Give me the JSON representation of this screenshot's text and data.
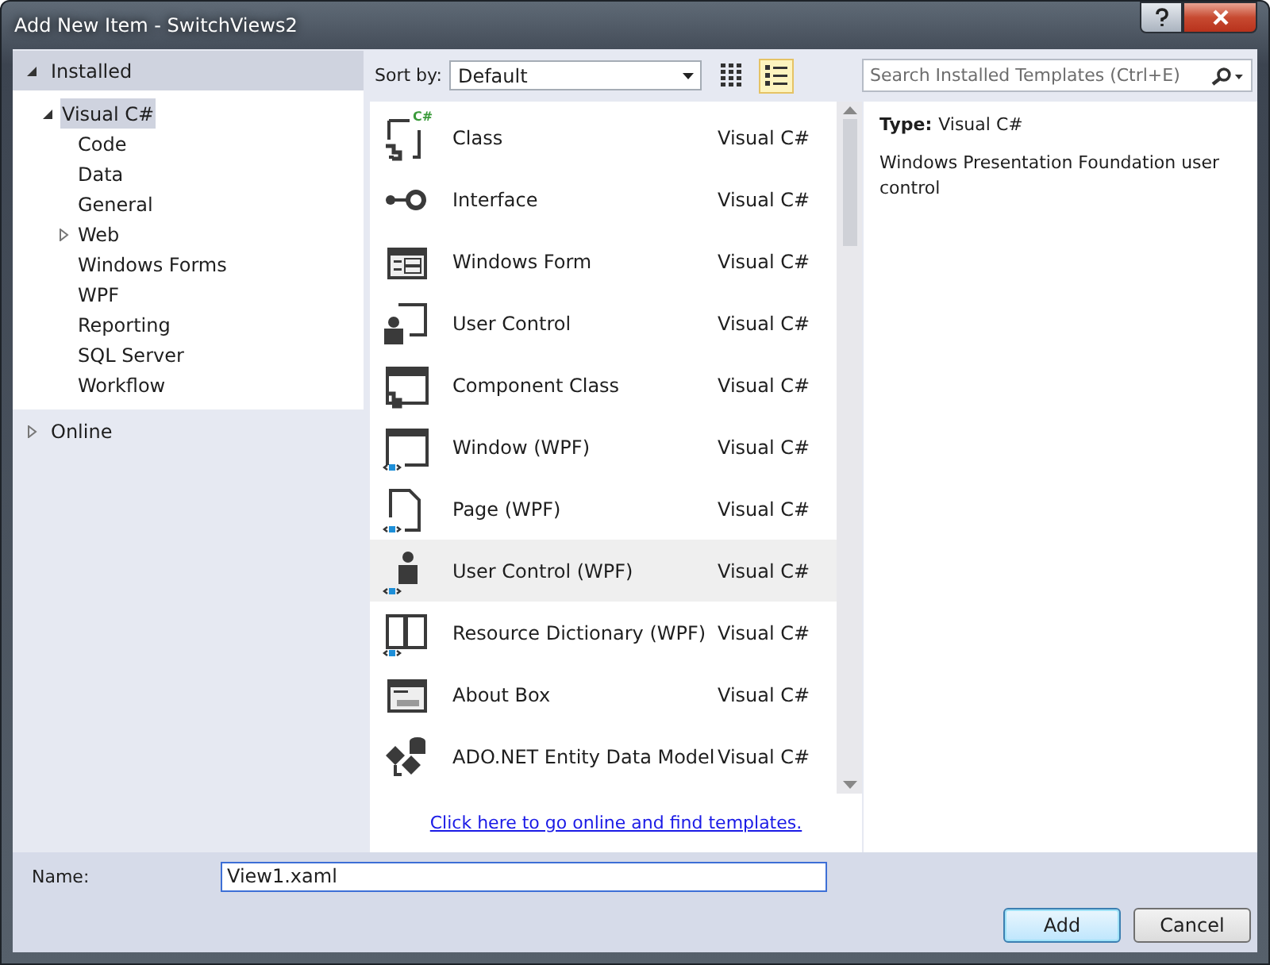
{
  "window": {
    "title": "Add New Item - SwitchViews2"
  },
  "sidebar": {
    "sections": [
      {
        "label": "Installed",
        "expanded": true,
        "children": [
          {
            "label": "Visual C#",
            "selected": true,
            "expanded": true,
            "children": [
              {
                "label": "Code",
                "selected": false
              },
              {
                "label": "Data",
                "selected": false
              },
              {
                "label": "General",
                "selected": false
              },
              {
                "label": "Web",
                "selected": false,
                "expanded": false
              },
              {
                "label": "Windows Forms",
                "selected": false
              },
              {
                "label": "WPF",
                "selected": false
              },
              {
                "label": "Reporting",
                "selected": false
              },
              {
                "label": "SQL Server",
                "selected": false
              },
              {
                "label": "Workflow",
                "selected": false
              }
            ]
          }
        ]
      },
      {
        "label": "Online",
        "expanded": false
      }
    ]
  },
  "toolbar": {
    "sort_label": "Sort by:",
    "sort_value": "Default",
    "views": [
      {
        "kind": "small-icons",
        "selected": false
      },
      {
        "kind": "list",
        "selected": true
      }
    ],
    "search": {
      "placeholder": "Search Installed Templates (Ctrl+E)"
    }
  },
  "templates": [
    {
      "name": "Class",
      "language": "Visual C#",
      "selected": false,
      "icon_badge": "C#"
    },
    {
      "name": "Interface",
      "language": "Visual C#",
      "selected": false
    },
    {
      "name": "Windows Form",
      "language": "Visual C#",
      "selected": false
    },
    {
      "name": "User Control",
      "language": "Visual C#",
      "selected": false
    },
    {
      "name": "Component Class",
      "language": "Visual C#",
      "selected": false
    },
    {
      "name": "Window (WPF)",
      "language": "Visual C#",
      "selected": false
    },
    {
      "name": "Page (WPF)",
      "language": "Visual C#",
      "selected": false
    },
    {
      "name": "User Control (WPF)",
      "language": "Visual C#",
      "selected": true
    },
    {
      "name": "Resource Dictionary (WPF)",
      "language": "Visual C#",
      "selected": false
    },
    {
      "name": "About Box",
      "language": "Visual C#",
      "selected": false
    },
    {
      "name": "ADO.NET Entity Data Model",
      "language": "Visual C#",
      "selected": false
    }
  ],
  "online_link": "Click here to go online and find templates.",
  "details": {
    "type_label": "Type:",
    "type_value": "Visual C#",
    "description": "Windows Presentation Foundation user control"
  },
  "name_field": {
    "label": "Name:",
    "value": "View1.xaml"
  },
  "buttons": [
    {
      "label": "Add",
      "kind": "default"
    },
    {
      "label": "Cancel",
      "kind": "normal"
    }
  ]
}
